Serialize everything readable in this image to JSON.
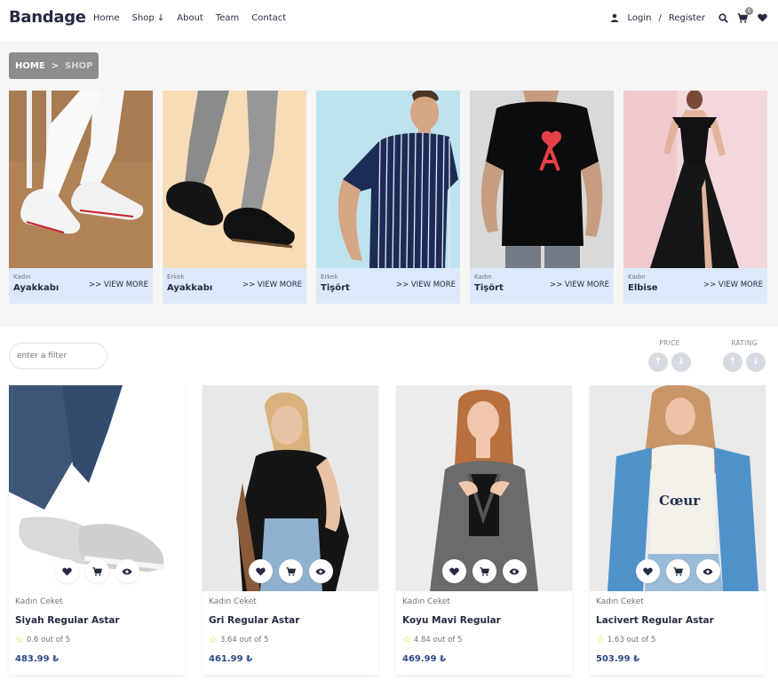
{
  "brand": "Bandage",
  "nav": {
    "home": "Home",
    "shop": "Shop",
    "shop_arrow": "↓",
    "about": "About",
    "team": "Team",
    "contact": "Contact"
  },
  "header": {
    "login": "Login",
    "separator": "/",
    "register": "Register",
    "cart_count": "0",
    "icons": [
      "user-icon",
      "search-icon",
      "cart-icon",
      "heart-icon"
    ]
  },
  "breadcrumb": {
    "home": "HOME",
    "separator": ">",
    "current": "SHOP"
  },
  "categories": [
    {
      "sub": "Kadın",
      "title": "Ayakkabı",
      "more": ">> VIEW MORE"
    },
    {
      "sub": "Erkek",
      "title": "Ayakkabı",
      "more": ">> VIEW MORE"
    },
    {
      "sub": "Erkek",
      "title": "Tişört",
      "more": ">> VIEW MORE"
    },
    {
      "sub": "Kadın",
      "title": "Tişört",
      "more": ">> VIEW MORE"
    },
    {
      "sub": "Kadın",
      "title": "Elbise",
      "more": ">> VIEW MORE"
    }
  ],
  "filter": {
    "placeholder": "enter a filter"
  },
  "sort": {
    "price_label": "PRICE",
    "rating_label": "RATING",
    "asc": "↑",
    "desc": "↓"
  },
  "products": [
    {
      "sub": "Kadın Ceket",
      "title": "Siyah Regular Astar",
      "rating": "0.6 out of 5",
      "price": "483.99 ₺"
    },
    {
      "sub": "Kadın Ceket",
      "title": "Gri Regular Astar",
      "rating": "3.64 out of 5",
      "price": "461.99 ₺"
    },
    {
      "sub": "Kadın Ceket",
      "title": "Koyu Mavi Regular",
      "rating": "4.84 out of 5",
      "price": "469.99 ₺"
    },
    {
      "sub": "Kadın Ceket",
      "title": "Lacivert Regular Astar",
      "rating": "1.63 out of 5",
      "price": "503.99 ₺"
    }
  ],
  "colors": {
    "text_dark": "#252b42",
    "muted": "#737373",
    "category_panel": "#dce9fb",
    "price": "#2a4a85",
    "star": "#f3cd03",
    "breadcrumb_bg": "#8d8d8d"
  }
}
